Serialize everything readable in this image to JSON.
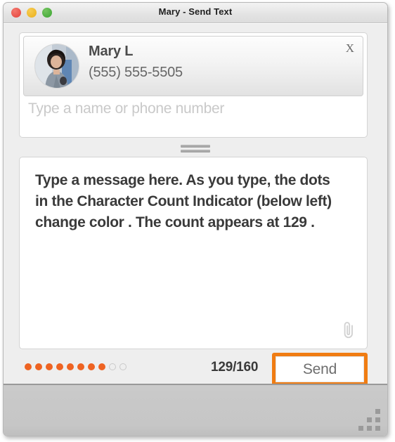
{
  "window": {
    "title": "Mary - Send Text",
    "traffic_lights": [
      {
        "name": "close",
        "color": "#e8524a"
      },
      {
        "name": "minimize",
        "color": "#eeb82b"
      },
      {
        "name": "zoom",
        "color": "#4cae3f"
      }
    ]
  },
  "recipient": {
    "contact": {
      "name": "Mary L",
      "phone": "(555) 555-5505",
      "avatar_icon": "person-photo-avatar",
      "remove_label": "X"
    },
    "input_value": "",
    "input_placeholder": "Type a name or phone number"
  },
  "splitter": {
    "icon": "drag-handle-icon"
  },
  "message": {
    "text": "Type a message here. As you type, the dots in the Character Count Indicator (below left) change color . The count appears at 129 .",
    "attach_icon": "paperclip-icon"
  },
  "footer": {
    "character_count_indicator": {
      "filled": 8,
      "empty": 2,
      "total": 10,
      "filled_color": "#ee6322",
      "empty_color": "#c9c9c9"
    },
    "char_count": "129/160",
    "send_label": "Send",
    "highlight_color": "#f07c12"
  },
  "statusbar": {
    "resize_grip_icon": "resize-grip-icon"
  }
}
